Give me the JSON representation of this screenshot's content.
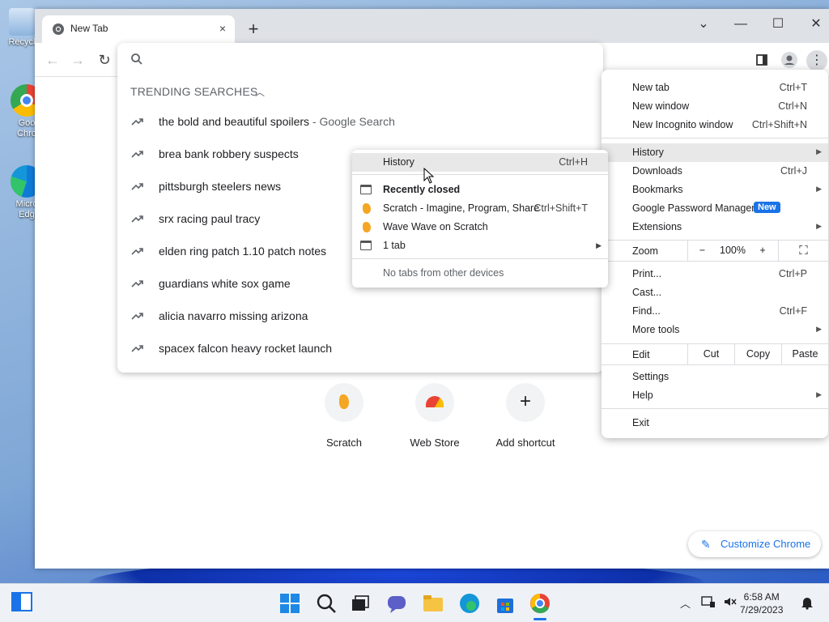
{
  "desktop": {
    "icons": [
      {
        "label": "Recycl"
      },
      {
        "label": "Goo\nChro"
      },
      {
        "label": "Micro\nEdg"
      }
    ]
  },
  "browser": {
    "tab_title": "New Tab",
    "tab_close": "×",
    "new_tab": "+",
    "window_controls": {
      "dropdown": "⌄",
      "minimize": "—",
      "maximize": "☐",
      "close": "✕"
    }
  },
  "omnibox": {
    "trending_header": "TRENDING SEARCHES",
    "suggestions": [
      {
        "text": "the bold and beautiful spoilers",
        "suffix": " - Google Search"
      },
      {
        "text": "brea bank robbery suspects",
        "suffix": ""
      },
      {
        "text": "pittsburgh steelers news",
        "suffix": ""
      },
      {
        "text": "srx racing paul tracy",
        "suffix": ""
      },
      {
        "text": "elden ring patch 1.10 patch notes",
        "suffix": ""
      },
      {
        "text": "guardians white sox game",
        "suffix": ""
      },
      {
        "text": "alicia navarro missing arizona",
        "suffix": ""
      },
      {
        "text": "spacex falcon heavy rocket launch",
        "suffix": ""
      }
    ]
  },
  "ntp": {
    "shortcuts": [
      {
        "label": "Scratch"
      },
      {
        "label": "Web Store"
      },
      {
        "label": "Add shortcut"
      }
    ],
    "customize_label": "Customize Chrome"
  },
  "menu": {
    "new_tab": {
      "label": "New tab",
      "shortcut": "Ctrl+T"
    },
    "new_window": {
      "label": "New window",
      "shortcut": "Ctrl+N"
    },
    "new_incognito": {
      "label": "New Incognito window",
      "shortcut": "Ctrl+Shift+N"
    },
    "history": {
      "label": "History"
    },
    "downloads": {
      "label": "Downloads",
      "shortcut": "Ctrl+J"
    },
    "bookmarks": {
      "label": "Bookmarks"
    },
    "password_manager": {
      "label": "Google Password Manager",
      "badge": "New"
    },
    "extensions": {
      "label": "Extensions"
    },
    "zoom": {
      "label": "Zoom",
      "minus": "−",
      "value": "100%",
      "plus": "+"
    },
    "print": {
      "label": "Print...",
      "shortcut": "Ctrl+P"
    },
    "cast": {
      "label": "Cast..."
    },
    "find": {
      "label": "Find...",
      "shortcut": "Ctrl+F"
    },
    "more_tools": {
      "label": "More tools"
    },
    "edit": {
      "label": "Edit",
      "cut": "Cut",
      "copy": "Copy",
      "paste": "Paste"
    },
    "settings": {
      "label": "Settings"
    },
    "help": {
      "label": "Help"
    },
    "exit": {
      "label": "Exit"
    }
  },
  "history_submenu": {
    "history": {
      "label": "History",
      "shortcut": "Ctrl+H"
    },
    "recently_closed": "Recently closed",
    "items": [
      {
        "label": "Scratch - Imagine, Program, Share",
        "shortcut": "Ctrl+Shift+T"
      },
      {
        "label": "Wave Wave on Scratch",
        "shortcut": ""
      },
      {
        "label": "1 tab",
        "shortcut": ""
      }
    ],
    "no_other_devices": "No tabs from other devices"
  },
  "taskbar": {
    "time": "6:58 AM",
    "date": "7/29/2023"
  },
  "colors": {
    "accent": "#1a73e8",
    "menu_highlight": "#e8e8e8",
    "scratch": "#f5a623"
  }
}
